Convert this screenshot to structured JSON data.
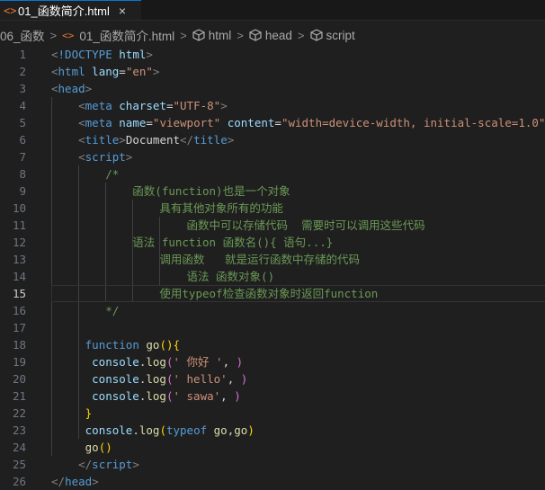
{
  "tab": {
    "icon": "html-file-icon",
    "label": "01_函数简介.html",
    "close": "×"
  },
  "breadcrumb": {
    "folder": "06_函数",
    "file": "01_函数简介.html",
    "html": "html",
    "head": "head",
    "script": "script"
  },
  "editor": {
    "current_line": 15,
    "lines": [
      {
        "n": "1",
        "tokens": [
          [
            "punct",
            "<"
          ],
          [
            "tag",
            "!DOCTYPE"
          ],
          [
            "text",
            " "
          ],
          [
            "attr",
            "html"
          ],
          [
            "punct",
            ">"
          ]
        ]
      },
      {
        "n": "2",
        "tokens": [
          [
            "punct",
            "<"
          ],
          [
            "tag",
            "html"
          ],
          [
            "text",
            " "
          ],
          [
            "attr",
            "lang"
          ],
          [
            "text",
            "="
          ],
          [
            "str",
            "\"en\""
          ],
          [
            "punct",
            ">"
          ]
        ]
      },
      {
        "n": "3",
        "tokens": [
          [
            "punct",
            "<"
          ],
          [
            "tag",
            "head"
          ],
          [
            "punct",
            ">"
          ]
        ]
      },
      {
        "n": "4",
        "tokens": [
          [
            "text",
            "    "
          ],
          [
            "punct",
            "<"
          ],
          [
            "tag",
            "meta"
          ],
          [
            "text",
            " "
          ],
          [
            "attr",
            "charset"
          ],
          [
            "text",
            "="
          ],
          [
            "str",
            "\"UTF-8\""
          ],
          [
            "punct",
            ">"
          ]
        ]
      },
      {
        "n": "5",
        "tokens": [
          [
            "text",
            "    "
          ],
          [
            "punct",
            "<"
          ],
          [
            "tag",
            "meta"
          ],
          [
            "text",
            " "
          ],
          [
            "attr",
            "name"
          ],
          [
            "text",
            "="
          ],
          [
            "str",
            "\"viewport\""
          ],
          [
            "text",
            " "
          ],
          [
            "attr",
            "content"
          ],
          [
            "text",
            "="
          ],
          [
            "str",
            "\"width=device-width, initial-scale=1.0\""
          ],
          [
            "punct",
            ">"
          ]
        ]
      },
      {
        "n": "6",
        "tokens": [
          [
            "text",
            "    "
          ],
          [
            "punct",
            "<"
          ],
          [
            "tag",
            "title"
          ],
          [
            "punct",
            ">"
          ],
          [
            "text",
            "Document"
          ],
          [
            "punct",
            "</"
          ],
          [
            "tag",
            "title"
          ],
          [
            "punct",
            ">"
          ]
        ]
      },
      {
        "n": "7",
        "tokens": [
          [
            "text",
            "    "
          ],
          [
            "punct",
            "<"
          ],
          [
            "tag",
            "script"
          ],
          [
            "punct",
            ">"
          ]
        ]
      },
      {
        "n": "8",
        "tokens": [
          [
            "com",
            "        /*"
          ]
        ]
      },
      {
        "n": "9",
        "tokens": [
          [
            "com",
            "            函数(function)也是一个对象"
          ]
        ]
      },
      {
        "n": "10",
        "tokens": [
          [
            "com",
            "                具有其他对象所有的功能"
          ]
        ]
      },
      {
        "n": "11",
        "tokens": [
          [
            "com",
            "                    函数中可以存储代码  需要时可以调用这些代码"
          ]
        ]
      },
      {
        "n": "12",
        "tokens": [
          [
            "com",
            "            语法 function 函数名(){ 语句...}"
          ]
        ]
      },
      {
        "n": "13",
        "tokens": [
          [
            "com",
            "                调用函数   就是运行函数中存储的代码"
          ]
        ]
      },
      {
        "n": "14",
        "tokens": [
          [
            "com",
            "                    语法 函数对象()"
          ]
        ]
      },
      {
        "n": "15",
        "tokens": [
          [
            "com",
            "                使用typeof检查函数对象时返回function"
          ]
        ]
      },
      {
        "n": "16",
        "tokens": [
          [
            "com",
            "        */"
          ]
        ]
      },
      {
        "n": "17",
        "tokens": []
      },
      {
        "n": "18",
        "tokens": [
          [
            "text",
            "     "
          ],
          [
            "kw",
            "function"
          ],
          [
            "text",
            " "
          ],
          [
            "fn",
            "go"
          ],
          [
            "brace",
            "()"
          ],
          [
            "brace",
            "{"
          ]
        ]
      },
      {
        "n": "19",
        "tokens": [
          [
            "text",
            "      "
          ],
          [
            "id",
            "console"
          ],
          [
            "text",
            "."
          ],
          [
            "fn",
            "log"
          ],
          [
            "paren",
            "("
          ],
          [
            "str",
            "' 你好 '"
          ],
          [
            "text",
            ", "
          ],
          [
            "paren",
            ")"
          ]
        ]
      },
      {
        "n": "20",
        "tokens": [
          [
            "text",
            "      "
          ],
          [
            "id",
            "console"
          ],
          [
            "text",
            "."
          ],
          [
            "fn",
            "log"
          ],
          [
            "paren",
            "("
          ],
          [
            "str",
            "' hello'"
          ],
          [
            "text",
            ", "
          ],
          [
            "paren",
            ")"
          ]
        ]
      },
      {
        "n": "21",
        "tokens": [
          [
            "text",
            "      "
          ],
          [
            "id",
            "console"
          ],
          [
            "text",
            "."
          ],
          [
            "fn",
            "log"
          ],
          [
            "paren",
            "("
          ],
          [
            "str",
            "' sawa'"
          ],
          [
            "text",
            ", "
          ],
          [
            "paren",
            ")"
          ]
        ]
      },
      {
        "n": "22",
        "tokens": [
          [
            "text",
            "     "
          ],
          [
            "brace",
            "}"
          ]
        ]
      },
      {
        "n": "23",
        "tokens": [
          [
            "text",
            "     "
          ],
          [
            "id",
            "console"
          ],
          [
            "text",
            "."
          ],
          [
            "fn",
            "log"
          ],
          [
            "brace",
            "("
          ],
          [
            "kw",
            "typeof"
          ],
          [
            "text",
            " "
          ],
          [
            "fn",
            "go"
          ],
          [
            "text",
            ","
          ],
          [
            "fn",
            "go"
          ],
          [
            "brace",
            ")"
          ]
        ]
      },
      {
        "n": "24",
        "tokens": [
          [
            "text",
            "     "
          ],
          [
            "fn",
            "go"
          ],
          [
            "brace",
            "()"
          ]
        ]
      },
      {
        "n": "25",
        "tokens": [
          [
            "text",
            "    "
          ],
          [
            "punct",
            "</"
          ],
          [
            "tag",
            "script"
          ],
          [
            "punct",
            ">"
          ]
        ]
      },
      {
        "n": "26",
        "tokens": [
          [
            "punct",
            "</"
          ],
          [
            "tag",
            "head"
          ],
          [
            "punct",
            ">"
          ]
        ]
      }
    ]
  }
}
